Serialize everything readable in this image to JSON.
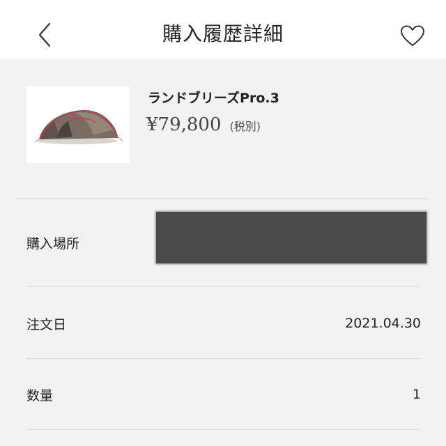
{
  "header": {
    "title": "購入履歴詳細",
    "back_icon": "chevron-left-icon",
    "favorite_icon": "heart-outline-icon"
  },
  "product": {
    "name": "ランドブリーズPro.3",
    "price": "¥79,800",
    "tax_note": "(税別)",
    "image": "tent-thumbnail"
  },
  "details": {
    "purchase_place_label": "購入場所",
    "purchase_place_value": "",
    "order_date_label": "注文日",
    "order_date_value": "2021.04.30",
    "quantity_label": "数量",
    "quantity_value": "1"
  }
}
